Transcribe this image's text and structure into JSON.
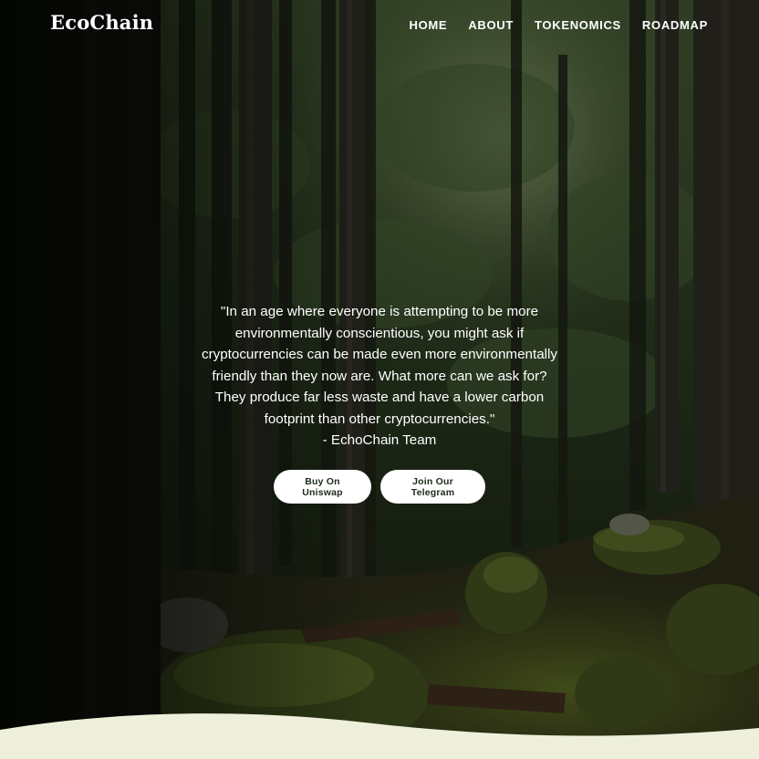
{
  "brand": {
    "name": "EcoChain"
  },
  "nav": {
    "items": [
      {
        "label": "HOME"
      },
      {
        "label": "ABOUT"
      },
      {
        "label": "TOKENOMICS"
      },
      {
        "label": "ROADMAP"
      }
    ]
  },
  "hero": {
    "quote": "\"In an age where everyone is attempting to be more environmentally conscientious, you might ask if cryptocurrencies can be made even more environmentally friendly than they now are. What more can we ask for? They produce far less waste and have a lower carbon footprint than other cryptocurrencies.\"",
    "attribution": "- EchoChain Team",
    "buttons": {
      "uniswap": "Buy On Uniswap",
      "telegram": "Join Our Telegram"
    },
    "background_image": "forest-photo"
  },
  "colors": {
    "nav_text": "#ffffff",
    "button_bg": "#ffffff",
    "button_text": "#1c2a1c",
    "wave_fill": "#eef0dc"
  }
}
